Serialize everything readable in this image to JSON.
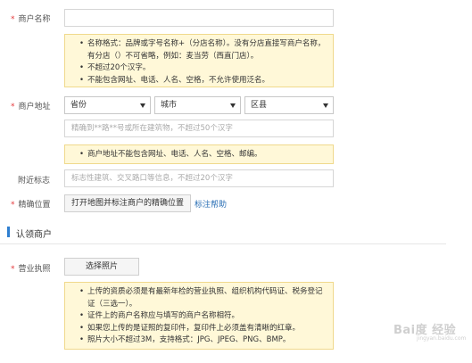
{
  "form": {
    "merchant_name": {
      "label": "商户名称",
      "required_mark": "*",
      "value": "",
      "tips": [
        "名称格式：品牌或字号名称+（分店名称）。没有分店直接写商户名称，有分店（）不可省略，例如：麦当劳（西直门店）。",
        "不超过20个汉字。",
        "不能包含网址、电话、人名、空格，不允许使用泛名。"
      ]
    },
    "merchant_address": {
      "label": "商户地址",
      "required_mark": "*",
      "province": "省份",
      "city": "城市",
      "district": "区县",
      "detail_placeholder": "精确到**路**号或所在建筑物，不超过50个汉字",
      "tips": [
        "商户地址不能包含网址、电话、人名、空格、邮编。"
      ]
    },
    "nearby_landmark": {
      "label": "附近标志",
      "placeholder": "标志性建筑、交叉路口等信息，不超过20个汉字"
    },
    "precise_location": {
      "label": "精确位置",
      "required_mark": "*",
      "open_map_button": "打开地图并标注商户的精确位置",
      "help_link": "标注帮助"
    }
  },
  "section": {
    "title": "认领商户"
  },
  "license": {
    "label": "营业执照",
    "required_mark": "*",
    "select_photo_button": "选择照片",
    "tips": [
      "上传的资质必须是有最新年检的营业执照、组织机构代码证、税务登记证（三选一）。",
      "证件上的商户名称应与填写的商户名称相符。",
      "如果您上传的是证照的复印件，复印件上必须盖有清晰的红章。",
      "照片大小不超过3M，支持格式：JPG、JPEG、PNG、BMP。"
    ]
  },
  "watermark": {
    "text": "Bai度 经验",
    "sub": "jingyan.baidu.com"
  }
}
